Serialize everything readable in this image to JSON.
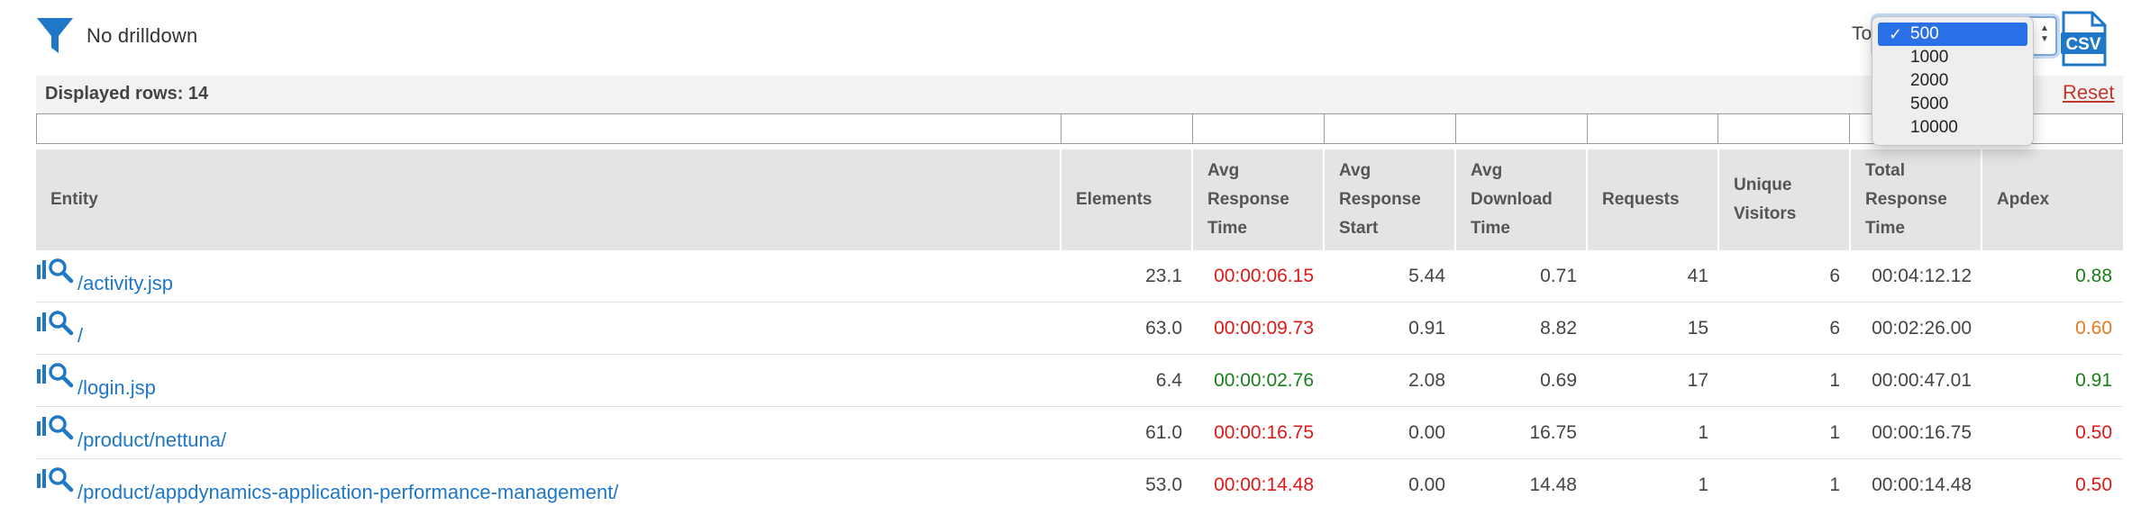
{
  "drilldown": {
    "icon": "filter-icon",
    "label": "No drilldown"
  },
  "topn": {
    "label": "To",
    "options": [
      "500",
      "1000",
      "2000",
      "5000",
      "10000"
    ],
    "selected": "500",
    "selected_index": 0,
    "check_glyph": "✓"
  },
  "csv": {
    "icon": "csv-export-icon",
    "label": "CSV"
  },
  "summary": {
    "displayed_rows": "Displayed rows: 14",
    "reset": "Reset"
  },
  "colors": {
    "link": "#1f77c7",
    "red": "#e01818",
    "green": "#1a7f1a",
    "orange": "#e8791f",
    "header_bg": "#e4e4e4",
    "select_highlight": "#2a71e8"
  },
  "columns": [
    {
      "key": "entity",
      "label": "Entity"
    },
    {
      "key": "elements",
      "label": "Elements"
    },
    {
      "key": "avg_response_time",
      "label": "Avg Response Time"
    },
    {
      "key": "avg_response_start",
      "label": "Avg Response Start"
    },
    {
      "key": "avg_download_time",
      "label": "Avg Download Time"
    },
    {
      "key": "requests",
      "label": "Requests"
    },
    {
      "key": "unique_visitors",
      "label": "Unique Visitors"
    },
    {
      "key": "total_response_time",
      "label": "Total Response Time"
    },
    {
      "key": "apdex",
      "label": "Apdex"
    }
  ],
  "rows": [
    {
      "entity": "/activity.jsp",
      "elements": "23.1",
      "avg_response_time": "00:00:06.15",
      "avg_response_time_status": "red",
      "avg_response_start": "5.44",
      "avg_download_time": "0.71",
      "requests": "41",
      "unique_visitors": "6",
      "total_response_time": "00:04:12.12",
      "apdex": "0.88",
      "apdex_status": "green"
    },
    {
      "entity": "/",
      "elements": "63.0",
      "avg_response_time": "00:00:09.73",
      "avg_response_time_status": "red",
      "avg_response_start": "0.91",
      "avg_download_time": "8.82",
      "requests": "15",
      "unique_visitors": "6",
      "total_response_time": "00:02:26.00",
      "apdex": "0.60",
      "apdex_status": "orange"
    },
    {
      "entity": "/login.jsp",
      "elements": "6.4",
      "avg_response_time": "00:00:02.76",
      "avg_response_time_status": "green",
      "avg_response_start": "2.08",
      "avg_download_time": "0.69",
      "requests": "17",
      "unique_visitors": "1",
      "total_response_time": "00:00:47.01",
      "apdex": "0.91",
      "apdex_status": "green"
    },
    {
      "entity": "/product/nettuna/",
      "elements": "61.0",
      "avg_response_time": "00:00:16.75",
      "avg_response_time_status": "red",
      "avg_response_start": "0.00",
      "avg_download_time": "16.75",
      "requests": "1",
      "unique_visitors": "1",
      "total_response_time": "00:00:16.75",
      "apdex": "0.50",
      "apdex_status": "red"
    },
    {
      "entity": "/product/appdynamics-application-performance-management/",
      "elements": "53.0",
      "avg_response_time": "00:00:14.48",
      "avg_response_time_status": "red",
      "avg_response_start": "0.00",
      "avg_download_time": "14.48",
      "requests": "1",
      "unique_visitors": "1",
      "total_response_time": "00:00:14.48",
      "apdex": "0.50",
      "apdex_status": "red"
    }
  ]
}
